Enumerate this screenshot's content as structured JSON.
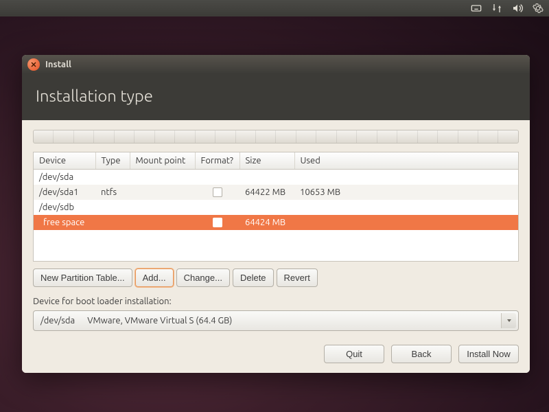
{
  "window": {
    "title": "Install"
  },
  "header": {
    "title": "Installation type"
  },
  "table": {
    "headers": [
      "Device",
      "Type",
      "Mount point",
      "Format?",
      "Size",
      "Used"
    ],
    "rows": [
      {
        "device": "/dev/sda",
        "type": "",
        "mount": "",
        "format": null,
        "size": "",
        "used": "",
        "level": 0,
        "selected": false
      },
      {
        "device": "/dev/sda1",
        "type": "ntfs",
        "mount": "",
        "format": false,
        "size": "64422 MB",
        "used": "10653 MB",
        "level": 1,
        "selected": false,
        "alt": true
      },
      {
        "device": "/dev/sdb",
        "type": "",
        "mount": "",
        "format": null,
        "size": "",
        "used": "",
        "level": 0,
        "selected": false
      },
      {
        "device": "free space",
        "type": "",
        "mount": "",
        "format": false,
        "size": "64424 MB",
        "used": "",
        "level": 1,
        "selected": true
      }
    ]
  },
  "partition_buttons": {
    "new_table": "New Partition Table...",
    "add": "Add...",
    "change": "Change...",
    "delete": "Delete",
    "revert": "Revert"
  },
  "bootloader": {
    "label": "Device for boot loader installation:",
    "selected_device": "/dev/sda",
    "selected_desc": "VMware, VMware Virtual S (64.4 GB)"
  },
  "footer": {
    "quit": "Quit",
    "back": "Back",
    "install": "Install Now"
  }
}
